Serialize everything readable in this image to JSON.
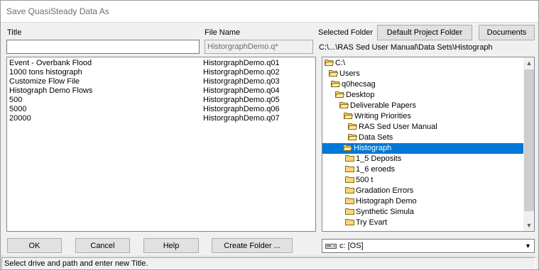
{
  "window": {
    "title": "Save QuasiSteady Data As"
  },
  "labels": {
    "title": "Title",
    "file_name": "File Name",
    "selected_folder": "Selected Folder"
  },
  "inputs": {
    "title_value": "",
    "file_name_value": "HistorgraphDemo.q*"
  },
  "buttons": {
    "default_project_folder": "Default Project Folder",
    "documents": "Documents",
    "ok": "OK",
    "cancel": "Cancel",
    "help": "Help",
    "create_folder": "Create Folder ..."
  },
  "selected_path": "C:\\...\\RAS Sed User Manual\\Data Sets\\Histograph",
  "files": [
    {
      "title": "Event - Overbank Flood",
      "file": "HistorgraphDemo.q01"
    },
    {
      "title": "1000 tons histograph",
      "file": "HistorgraphDemo.q02"
    },
    {
      "title": "Customize Flow File",
      "file": "HistorgraphDemo.q03"
    },
    {
      "title": "Histograph Demo Flows",
      "file": "HistorgraphDemo.q04"
    },
    {
      "title": "500",
      "file": "HistorgraphDemo.q05"
    },
    {
      "title": "5000",
      "file": "HistorgraphDemo.q06"
    },
    {
      "title": "20000",
      "file": "HistorgraphDemo.q07"
    }
  ],
  "tree": [
    {
      "label": "C:\\",
      "open": true
    },
    {
      "label": "Users",
      "open": true
    },
    {
      "label": "q0hecsag",
      "open": true
    },
    {
      "label": "Desktop",
      "open": true
    },
    {
      "label": "Deliverable Papers",
      "open": true
    },
    {
      "label": "Writing Priorities",
      "open": true
    },
    {
      "label": "RAS Sed User Manual",
      "open": true
    },
    {
      "label": "Data Sets",
      "open": true
    },
    {
      "label": "Histograph",
      "open": true,
      "selected": true
    },
    {
      "label": "1_5 Deposits",
      "open": false
    },
    {
      "label": "1_6 eroeds",
      "open": false
    },
    {
      "label": "500 t",
      "open": false
    },
    {
      "label": "Gradation Errors",
      "open": false
    },
    {
      "label": "Histograph Demo",
      "open": false
    },
    {
      "label": "Synthetic Simula",
      "open": false
    },
    {
      "label": "Try Evart",
      "open": false
    }
  ],
  "drive": {
    "value": "c: [OS]"
  },
  "status": "Select drive and path and enter new Title.",
  "colors": {
    "selection": "#0078d7",
    "folder": "#f8d775"
  }
}
